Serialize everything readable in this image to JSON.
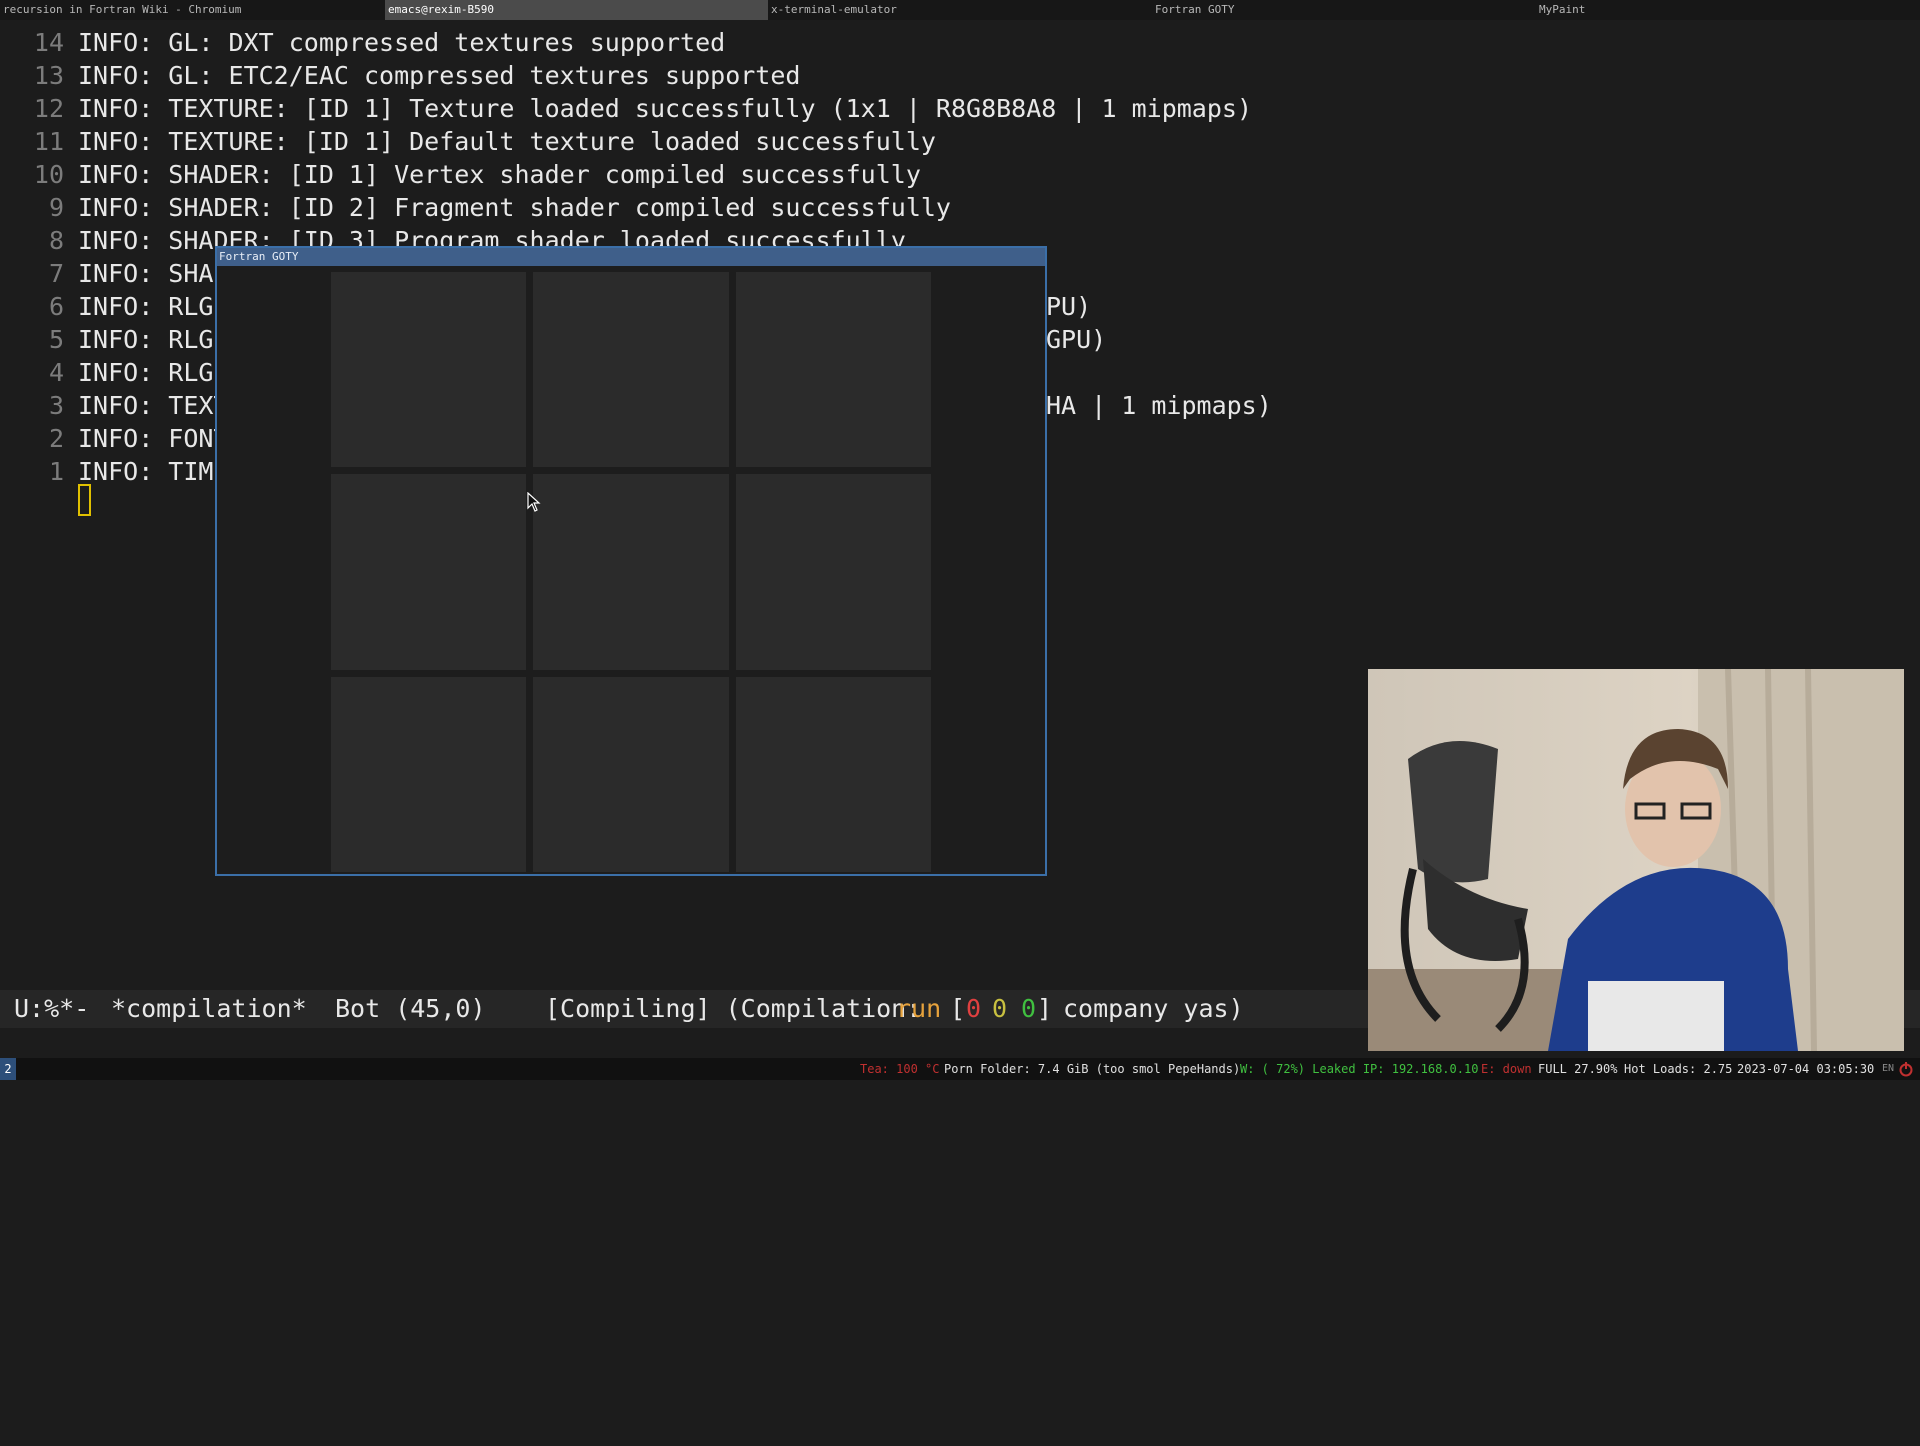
{
  "topbar": {
    "tabs": [
      {
        "label": "recursion in Fortran Wiki - Chromium",
        "active": false
      },
      {
        "label": "emacs@rexim-B590",
        "active": true
      },
      {
        "label": "x-terminal-emulator",
        "active": false
      },
      {
        "label": "Fortran GOTY",
        "active": false
      },
      {
        "label": "MyPaint",
        "active": false
      }
    ]
  },
  "buffer": {
    "lines": [
      {
        "num": "14",
        "text": "INFO: GL: DXT compressed textures supported"
      },
      {
        "num": "13",
        "text": "INFO: GL: ETC2/EAC compressed textures supported"
      },
      {
        "num": "12",
        "text": "INFO: TEXTURE: [ID 1] Texture loaded successfully (1x1 | R8G8B8A8 | 1 mipmaps)"
      },
      {
        "num": "11",
        "text": "INFO: TEXTURE: [ID 1] Default texture loaded successfully"
      },
      {
        "num": "10",
        "text": "INFO: SHADER: [ID 1] Vertex shader compiled successfully"
      },
      {
        "num": "9",
        "text": "INFO: SHADER: [ID 2] Fragment shader compiled successfully"
      },
      {
        "num": "8",
        "text": "INFO: SHADER: [ID 3] Program shader loaded successfully"
      },
      {
        "num": "7",
        "text": "INFO: SHAD"
      },
      {
        "num": "6",
        "text": "INFO: RLGL",
        "tail": "PU)"
      },
      {
        "num": "5",
        "text": "INFO: RLGL",
        "tail": "GPU)"
      },
      {
        "num": "4",
        "text": "INFO: RLGL",
        "tail": ""
      },
      {
        "num": "3",
        "text": "INFO: TEXT",
        "tail": "HA | 1 mipmaps)"
      },
      {
        "num": "2",
        "text": "INFO: FONT",
        "tail": ""
      },
      {
        "num": "1",
        "text": "INFO: TIME",
        "tail": ""
      }
    ]
  },
  "game_window": {
    "title": "Fortran GOTY",
    "cells": 9
  },
  "modeline": {
    "state": "U:%*-",
    "buffer_name": "*compilation*",
    "position": "Bot (45,0)",
    "mode_prefix": "[Compiling] (Compilation:",
    "mode_run": "run",
    "bracket_open": "[",
    "err": "0",
    "warn": "0",
    "info": "0",
    "bracket_close": "]",
    "minor_modes": "company yas)"
  },
  "statusbar": {
    "workspace": "2",
    "temp": "Tea: 100 °C",
    "folder": "Porn Folder: 7.4 GiB (too smol PepeHands)",
    "wifi": "W: ( 72%) Leaked IP: 192.168.0.10",
    "ethernet": "E: down",
    "battery": "FULL 27.90%",
    "load": "Hot Loads: 2.75",
    "datetime": "2023-07-04 03:05:30",
    "lang": "EN"
  },
  "colors": {
    "background": "#1c1c1c",
    "title_bar": "#3f5f8a",
    "cell": "#2b2b2b",
    "cursor": "#e0c000",
    "status_ok": "#40c040",
    "status_bad": "#e04040"
  }
}
